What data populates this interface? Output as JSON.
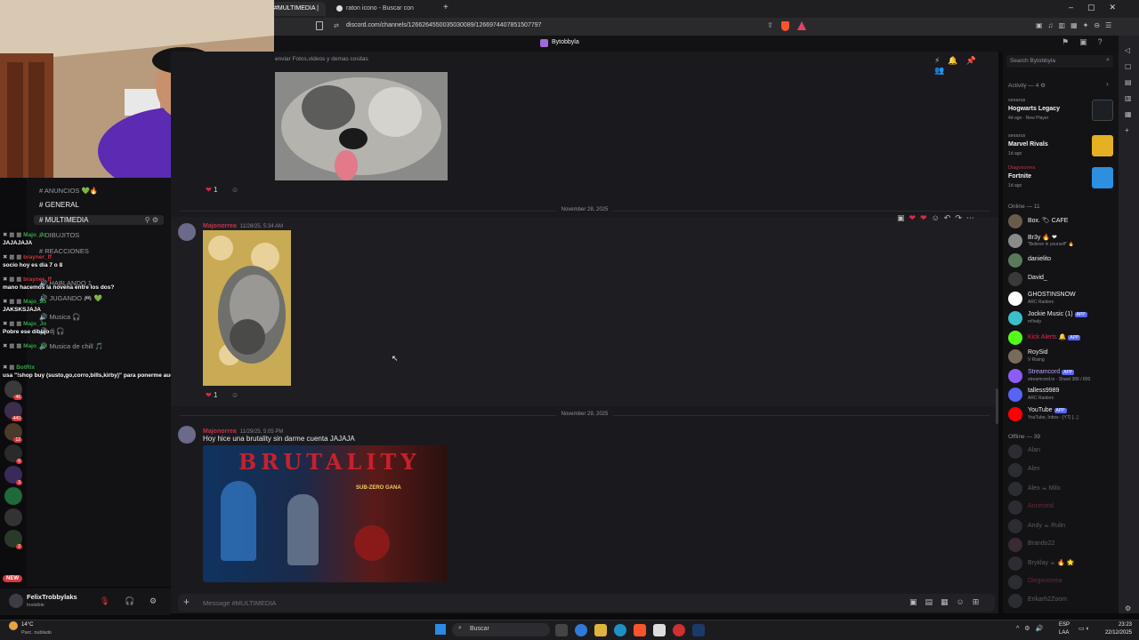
{
  "browser": {
    "tabs": [
      {
        "label": "#MULTIMEDIA |"
      },
      {
        "label": "raton icono - Buscar con Google"
      }
    ],
    "new_tab_label": "+",
    "url": "discord.com/channels/1266264550035030089/1266974407851507797"
  },
  "discord": {
    "server_title": "Bytobbyla",
    "channels": [
      {
        "label": "ANUNCIOS 💚🔥"
      },
      {
        "label": "GENERAL"
      },
      {
        "label": "MULTIMEDIA"
      },
      {
        "label": "DIBUJITOS"
      },
      {
        "label": "REACCIONES"
      },
      {
        "label": "HABLANDO 1"
      },
      {
        "label": "JUGANDO 🎮 💚"
      },
      {
        "label": "Musica 🎧"
      },
      {
        "label": "dj 🎧"
      },
      {
        "label": "Musica de chill 🎵"
      }
    ],
    "user_panel": {
      "name": "FelixTrobbylaks",
      "status": "Invisible"
    },
    "channel_topic": "enviar Fotos,videos y demas cositas",
    "search_placeholder": "Search Bytobbyla",
    "messages": [
      {
        "date_divider": "November 28, 2025",
        "author": "Majonorrea",
        "time": "11/28/25, 5:34 AM",
        "text": "",
        "reaction_count": "1"
      },
      {
        "date_divider": "November 29, 2025",
        "author": "Majonorrea",
        "time": "11/29/25, 5:05 PM",
        "text": "Hoy hice una brutality sin darme cuenta JAJAJA",
        "image_text": "BRUTALITY",
        "image_subtext": "SUB-ZERO GANA"
      }
    ],
    "first_reaction_count": "1",
    "message_placeholder": "Message #MULTIMEDIA",
    "activity": {
      "header": "Activity — 4",
      "cards": [
        {
          "user": "sesarus",
          "game": "Hogwarts Legacy",
          "meta": "4d ago · New Player",
          "thumb_color": "#1c1f24"
        },
        {
          "user": "sesarus",
          "game": "Marvel Rivals",
          "meta": "1d ago",
          "thumb_color": "#e5b021"
        },
        {
          "user": "Diagonorrea",
          "game": "Fortnite",
          "meta": "1d ago",
          "thumb_color": "#2d8fe0"
        }
      ]
    },
    "online_header": "Online — 11",
    "online": [
      {
        "name": "Box. 🏷 CAFE",
        "status": "",
        "color": "#6b5b4b"
      },
      {
        "name": "Br3y 🔥 ❤",
        "status": "\"Believe in yourself\" 🔥",
        "color": "#8a8a8a"
      },
      {
        "name": "danielito",
        "status": "",
        "color": "#5a7a5a"
      },
      {
        "name": "David_",
        "status": "",
        "color": "#3a3a3a"
      },
      {
        "name": "GHOSTINSNOW",
        "status": "ARC Raiders",
        "color": "#ffffff"
      },
      {
        "name": "Jockie Music (1)",
        "status": "m!help",
        "color": "#3ac0c8",
        "app": "APP"
      },
      {
        "name": "Kick Alerts 🔔",
        "status": "",
        "color": "#53fc18",
        "app": "APP"
      },
      {
        "name": "RoySid",
        "status": "V Rising",
        "color": "#7a6a5a"
      },
      {
        "name": "Streamcord",
        "status": "streamcord.io · Shard 386 / 800",
        "color": "#8b5cf6",
        "app": "APP"
      },
      {
        "name": "talless9989",
        "status": "ARC Raiders",
        "color": "#5865f2"
      },
      {
        "name": "YouTube",
        "status": "YouTube, Inbox - [YT] [...]",
        "color": "#ff0000",
        "app": "APP"
      }
    ],
    "offline_header": "Offline — 39",
    "offline": [
      {
        "name": "Alan"
      },
      {
        "name": "Alex"
      },
      {
        "name": "Alex ☕ Milo"
      },
      {
        "name": "Ancestral"
      },
      {
        "name": "Andy ☕ Rulin"
      },
      {
        "name": "Brando22"
      },
      {
        "name": "Bryklay ☕ 🔥 🌟"
      },
      {
        "name": "Diegonorrea"
      },
      {
        "name": "Erikarh2Zoom"
      }
    ]
  },
  "stream_overlay": {
    "chat": [
      {
        "user": "Majo_Jo",
        "text": "JAJAJAJA",
        "red": false
      },
      {
        "user": "brayner_ff",
        "text": "socio hoy es dia 7 o 8",
        "red": true
      },
      {
        "user": "brayner_ff",
        "text": "mano hacemos la novena entre los dos?",
        "red": true
      },
      {
        "user": "Majo_Jo",
        "text": "JAKSKSJAJA",
        "red": false
      },
      {
        "user": "Majo_Jo",
        "text": "Pobre ese dibujo",
        "red": false
      },
      {
        "user": "Majo_Jo",
        "text": "",
        "red": false
      },
      {
        "user": "BotRix",
        "text": "usa \"!shop buy (susto,go,corro,bills,kirby)\" para ponerme audios!",
        "red": false
      }
    ],
    "new_label": "NEW"
  },
  "taskbar": {
    "weather_temp": "14°C",
    "weather_desc": "Parc. nublado",
    "search_label": "Buscar",
    "lang": "ESP",
    "lang_sub": "LAA",
    "time": "23:23",
    "date": "22/12/2025"
  }
}
